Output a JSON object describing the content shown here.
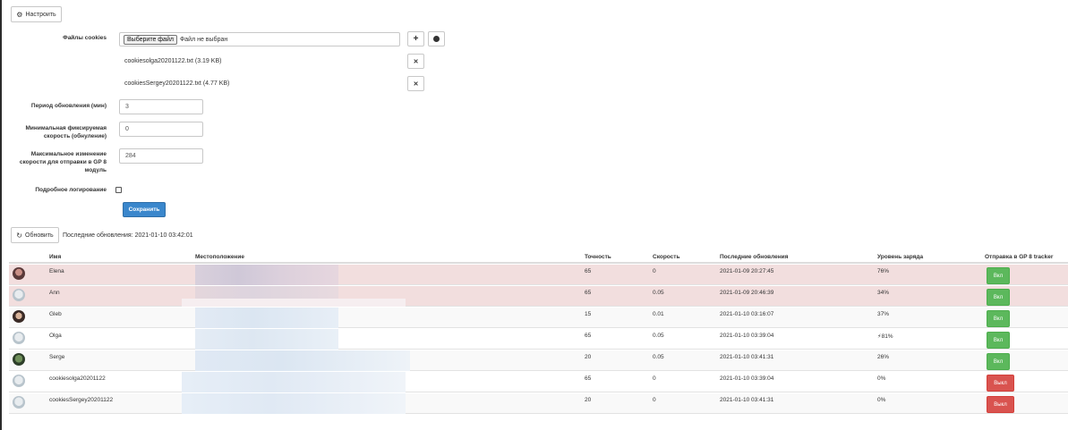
{
  "toolbar": {
    "settings_label": "Настроить",
    "refresh_label": "Обновить",
    "last_update_text": "Последние обновления: 2021-01-10 03:42:01"
  },
  "form": {
    "cookies_label": "Файлы cookies",
    "file_button_label": "Выберите файл",
    "file_status": "Файл не выбран",
    "files": [
      {
        "name": "cookiesolga20201122.txt (3.19 KB)"
      },
      {
        "name": "cookiesSergey20201122.txt (4.77 KB)"
      }
    ],
    "period_label": "Период обновления (мин)",
    "period_value": "3",
    "min_speed_label_1": "Минимальная фиксируемая",
    "min_speed_label_2": "скорость (обнуление)",
    "min_speed_value": "0",
    "max_change_label_1": "Максимальное изменение",
    "max_change_label_2": "скорости для отправки в GP 8",
    "max_change_label_3": "модуль",
    "max_change_value": "284",
    "verbose_label": "Подробное логирование",
    "save_label": "Сохранить"
  },
  "table": {
    "headers": {
      "name": "Имя",
      "location": "Местоположение",
      "accuracy": "Точность",
      "speed": "Скорость",
      "last_update": "Последние обновления",
      "battery": "Уровень заряда",
      "send": "Отправка в GP 8 tracker"
    },
    "rows": [
      {
        "name": "Elena",
        "accuracy": "65",
        "speed": "0",
        "updated": "2021-01-09 20:27:45",
        "battery": "76%",
        "state": "Вкл",
        "state_on": true,
        "highlight": "danger",
        "avatar": "photo-f"
      },
      {
        "name": "Ann",
        "accuracy": "65",
        "speed": "0.05",
        "updated": "2021-01-09 20:46:39",
        "battery": "34%",
        "state": "Вкл",
        "state_on": true,
        "highlight": "danger",
        "avatar": "default"
      },
      {
        "name": "Gleb",
        "accuracy": "15",
        "speed": "0.01",
        "updated": "2021-01-10 03:16:07",
        "battery": "37%",
        "state": "Вкл",
        "state_on": true,
        "highlight": "striped",
        "avatar": "photo-m"
      },
      {
        "name": "Olga",
        "accuracy": "65",
        "speed": "0.05",
        "updated": "2021-01-10 03:39:04",
        "battery": "81%",
        "battery_charging": true,
        "state": "Вкл",
        "state_on": true,
        "highlight": "none",
        "avatar": "default"
      },
      {
        "name": "Serge",
        "accuracy": "20",
        "speed": "0.05",
        "updated": "2021-01-10 03:41:31",
        "battery": "26%",
        "state": "Вкл",
        "state_on": true,
        "highlight": "striped",
        "avatar": "photo-g"
      },
      {
        "name": "cookiesolga20201122",
        "accuracy": "65",
        "speed": "0",
        "updated": "2021-01-10 03:39:04",
        "battery": "0%",
        "state": "Выкл",
        "state_on": false,
        "highlight": "none",
        "avatar": "default"
      },
      {
        "name": "cookiesSergey20201122",
        "accuracy": "20",
        "speed": "0",
        "updated": "2021-01-10 03:41:31",
        "battery": "0%",
        "state": "Выкл",
        "state_on": false,
        "highlight": "striped",
        "avatar": "default"
      }
    ]
  },
  "icons": {
    "settings": "gear-icon",
    "refresh": "refresh-icon",
    "add": "plus-icon",
    "google": "globe-icon",
    "remove": "close-icon",
    "charging": "lightning-icon"
  },
  "colors": {
    "primary": "#3a87cc",
    "success": "#5cb85c",
    "danger": "#d9534f",
    "danger_row": "#f2dede"
  }
}
